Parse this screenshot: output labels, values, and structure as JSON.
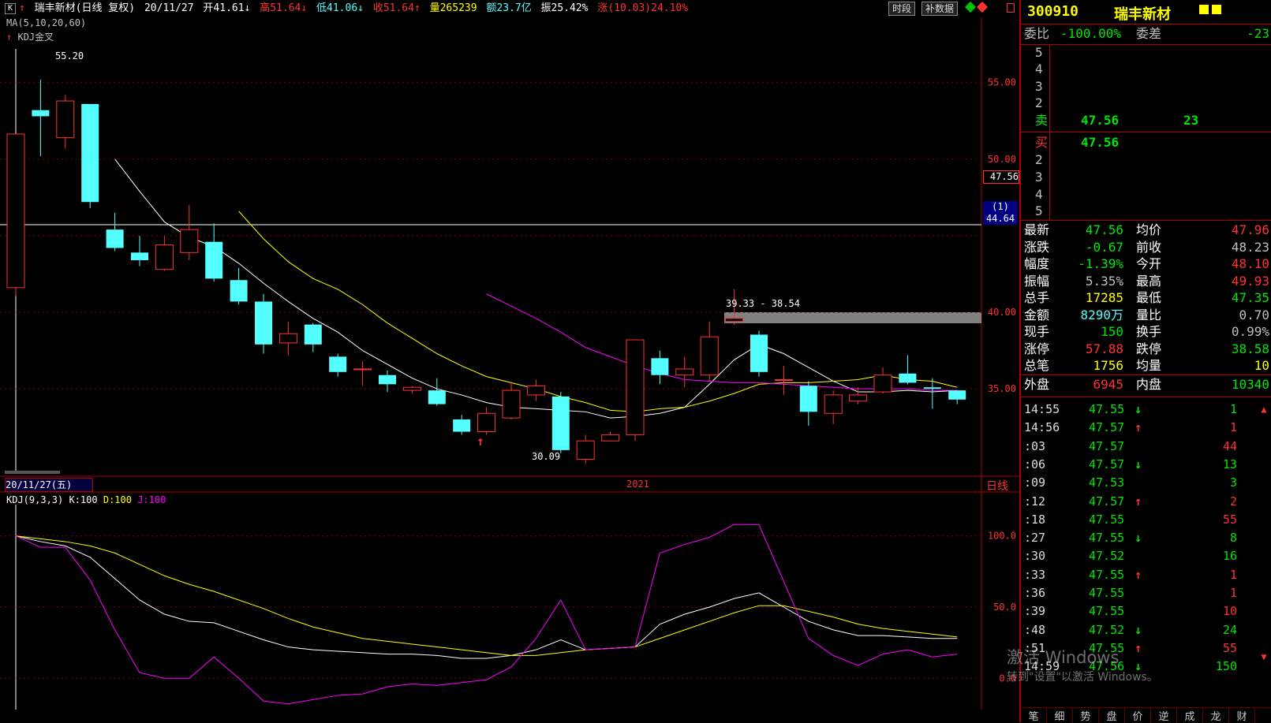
{
  "header": {
    "k_icon": "K",
    "name": "瑞丰新材(日线 复权)",
    "date": "20/11/27",
    "open": "开41.61↓",
    "high": "高51.64↓",
    "low": "低41.06↓",
    "close": "收51.64↑",
    "volume": "量265239",
    "amount": "额23.7亿",
    "amplitude": "振25.42%",
    "change": "涨(10.03)24.10%",
    "btn_timeshare": "时段",
    "btn_supplement": "补数据",
    "ma_legend": "MA(5,10,20,60)",
    "kdj_cross": "KDJ金叉"
  },
  "price_axis": [
    "55.00",
    "50.00",
    "47.56",
    "44.64",
    "40.00",
    "35.00"
  ],
  "price_axis_box": "(1)",
  "chart_labels": {
    "high_label": "55.20",
    "low_label": "30.09",
    "gap_label": "39.33 - 38.54",
    "date_box": "20/11/27(五)",
    "year_label": "2021",
    "period": "日线"
  },
  "kdj": {
    "legend_name": "KDJ(9,3,3)",
    "k": "K:100",
    "d": "D:100",
    "j": "J:100",
    "axis": [
      "100.0",
      "50.0",
      "0.0"
    ]
  },
  "colors": {
    "up": "#ff3232",
    "down": "#54ffff",
    "ma5": "#ffffff",
    "ma10": "#ffff00",
    "ma20": "#ff00ff",
    "panel_border": "#b00000"
  },
  "chart_data": {
    "type": "candlestick",
    "candles": [
      {
        "o": 41.61,
        "c": 51.64,
        "h": 51.64,
        "l": 41.06,
        "dir": "up"
      },
      {
        "o": 52.8,
        "c": 53.2,
        "h": 55.2,
        "l": 50.2,
        "dir": "down"
      },
      {
        "o": 51.4,
        "c": 53.8,
        "h": 54.2,
        "l": 50.7,
        "dir": "up"
      },
      {
        "o": 53.6,
        "c": 47.2,
        "h": 53.6,
        "l": 46.8,
        "dir": "down"
      },
      {
        "o": 45.4,
        "c": 44.2,
        "h": 46.5,
        "l": 44.0,
        "dir": "down"
      },
      {
        "o": 43.9,
        "c": 43.4,
        "h": 45.0,
        "l": 43.0,
        "dir": "down"
      },
      {
        "o": 42.8,
        "c": 44.4,
        "h": 45.0,
        "l": 42.7,
        "dir": "up"
      },
      {
        "o": 43.9,
        "c": 45.4,
        "h": 47.0,
        "l": 43.4,
        "dir": "up"
      },
      {
        "o": 44.6,
        "c": 42.2,
        "h": 45.8,
        "l": 42.0,
        "dir": "down"
      },
      {
        "o": 42.1,
        "c": 40.7,
        "h": 42.9,
        "l": 40.5,
        "dir": "down"
      },
      {
        "o": 40.7,
        "c": 37.9,
        "h": 41.2,
        "l": 37.3,
        "dir": "down"
      },
      {
        "o": 38.0,
        "c": 38.6,
        "h": 39.4,
        "l": 37.2,
        "dir": "up"
      },
      {
        "o": 39.2,
        "c": 37.9,
        "h": 39.3,
        "l": 37.4,
        "dir": "down"
      },
      {
        "o": 37.1,
        "c": 36.1,
        "h": 37.3,
        "l": 35.8,
        "dir": "down"
      },
      {
        "o": 36.3,
        "c": 36.3,
        "h": 36.8,
        "l": 35.2,
        "dir": "up"
      },
      {
        "o": 35.9,
        "c": 35.3,
        "h": 36.2,
        "l": 34.8,
        "dir": "down"
      },
      {
        "o": 34.9,
        "c": 35.1,
        "h": 35.2,
        "l": 34.7,
        "dir": "up"
      },
      {
        "o": 34.9,
        "c": 34.0,
        "h": 35.7,
        "l": 33.9,
        "dir": "down"
      },
      {
        "o": 33.0,
        "c": 32.2,
        "h": 33.3,
        "l": 32.0,
        "dir": "down"
      },
      {
        "o": 32.2,
        "c": 33.4,
        "h": 33.8,
        "l": 32.0,
        "dir": "up"
      },
      {
        "o": 33.1,
        "c": 34.9,
        "h": 35.4,
        "l": 33.0,
        "dir": "up"
      },
      {
        "o": 34.6,
        "c": 35.2,
        "h": 35.6,
        "l": 34.2,
        "dir": "up"
      },
      {
        "o": 34.5,
        "c": 31.0,
        "h": 34.8,
        "l": 30.8,
        "dir": "down"
      },
      {
        "o": 30.4,
        "c": 31.6,
        "h": 32.0,
        "l": 30.09,
        "dir": "up"
      },
      {
        "o": 31.6,
        "c": 32.0,
        "h": 32.2,
        "l": 31.6,
        "dir": "up"
      },
      {
        "o": 32.0,
        "c": 38.2,
        "h": 38.2,
        "l": 31.6,
        "dir": "up"
      },
      {
        "o": 37.0,
        "c": 35.9,
        "h": 37.5,
        "l": 35.3,
        "dir": "down"
      },
      {
        "o": 35.9,
        "c": 36.3,
        "h": 37.1,
        "l": 35.1,
        "dir": "up"
      },
      {
        "o": 35.9,
        "c": 38.4,
        "h": 39.4,
        "l": 35.5,
        "dir": "up"
      },
      {
        "o": 39.4,
        "c": 39.6,
        "h": 41.5,
        "l": 39.2,
        "dir": "up"
      },
      {
        "o": 38.54,
        "c": 36.1,
        "h": 38.8,
        "l": 35.8,
        "dir": "down"
      },
      {
        "o": 35.6,
        "c": 35.6,
        "h": 36.5,
        "l": 34.6,
        "dir": "up"
      },
      {
        "o": 35.2,
        "c": 33.5,
        "h": 35.5,
        "l": 32.6,
        "dir": "down"
      },
      {
        "o": 33.4,
        "c": 34.6,
        "h": 34.9,
        "l": 32.7,
        "dir": "up"
      },
      {
        "o": 34.2,
        "c": 34.6,
        "h": 35.1,
        "l": 34.0,
        "dir": "up"
      },
      {
        "o": 34.8,
        "c": 35.9,
        "h": 36.4,
        "l": 34.7,
        "dir": "up"
      },
      {
        "o": 36.0,
        "c": 35.4,
        "h": 37.2,
        "l": 35.3,
        "dir": "down"
      },
      {
        "o": 35.1,
        "c": 35.0,
        "h": 35.7,
        "l": 33.7,
        "dir": "down"
      },
      {
        "o": 34.9,
        "c": 34.3,
        "h": 34.9,
        "l": 34.0,
        "dir": "down"
      }
    ],
    "ma5": [
      null,
      null,
      null,
      null,
      50.0,
      47.9,
      45.9,
      44.9,
      44.3,
      43.2,
      41.9,
      40.7,
      39.6,
      38.7,
      37.5,
      36.6,
      35.7,
      35.0,
      34.6,
      34.1,
      33.8,
      33.7,
      33.6,
      33.5,
      33.1,
      33.2,
      33.4,
      33.8,
      35.3,
      36.9,
      37.9,
      37.3,
      36.4,
      35.5,
      34.8,
      34.8,
      34.9,
      34.8,
      34.9
    ],
    "ma10": [
      null,
      null,
      null,
      null,
      null,
      null,
      null,
      null,
      null,
      46.6,
      44.8,
      43.3,
      42.2,
      41.5,
      40.5,
      39.3,
      38.3,
      37.3,
      36.5,
      35.8,
      35.4,
      35.0,
      34.5,
      34.1,
      33.6,
      33.5,
      33.7,
      33.8,
      34.2,
      34.7,
      35.3,
      35.4,
      35.4,
      35.5,
      35.6,
      35.9,
      35.6,
      35.5,
      35.1
    ],
    "ma20": [
      null,
      null,
      null,
      null,
      null,
      null,
      null,
      null,
      null,
      null,
      null,
      null,
      null,
      null,
      null,
      null,
      null,
      null,
      null,
      41.2,
      40.4,
      39.6,
      38.7,
      37.7,
      37.1,
      36.5,
      36.0,
      35.6,
      35.5,
      35.4,
      35.4,
      35.3,
      35.2,
      35.1,
      35.0,
      35.0,
      35.0,
      34.9,
      34.9
    ],
    "kdj_k": [
      100,
      96,
      93,
      85,
      70,
      55,
      45,
      40,
      39,
      33,
      27,
      22,
      20,
      19,
      18,
      17,
      17,
      16,
      14,
      14,
      16,
      20,
      27,
      20,
      21,
      22,
      38,
      45,
      50,
      56,
      60,
      50,
      40,
      34,
      30,
      30,
      29,
      28,
      28
    ],
    "kdj_d": [
      100,
      98,
      96,
      93,
      88,
      80,
      72,
      66,
      61,
      55,
      49,
      42,
      36,
      32,
      28,
      26,
      24,
      22,
      20,
      18,
      16,
      16,
      18,
      20,
      21,
      22,
      28,
      34,
      40,
      46,
      51,
      51,
      47,
      43,
      38,
      35,
      33,
      31,
      29
    ],
    "kdj_j": [
      100,
      92,
      92,
      69,
      34,
      4,
      0,
      0,
      15,
      0,
      -16,
      -18,
      -15,
      -12,
      -11,
      -6,
      -4,
      -5,
      -3,
      -1,
      8,
      28,
      55,
      20,
      21,
      22,
      88,
      94,
      99,
      108,
      108,
      68,
      28,
      16,
      9,
      17,
      20,
      15,
      17
    ],
    "ylim_price": [
      29.5,
      57.2
    ],
    "ylim_kdj": [
      -22,
      122
    ]
  },
  "quote": {
    "code": "300910",
    "name": "瑞丰新材",
    "wei_bi_label": "委比",
    "wei_bi": "-100.00%",
    "wei_cha_label": "委差",
    "wei_cha": "-23",
    "sell_levels": [
      "5",
      "4",
      "3",
      "2"
    ],
    "sell_label": "卖",
    "sell_price": "47.56",
    "sell_vol": "23",
    "buy_label": "买",
    "buy_price": "47.56",
    "buy_levels": [
      "2",
      "3",
      "4",
      "5"
    ],
    "stats": [
      {
        "l1": "最新",
        "v1": "47.56",
        "c1": "green",
        "l2": "均价",
        "v2": "47.96",
        "c2": "red"
      },
      {
        "l1": "涨跌",
        "v1": "-0.67",
        "c1": "green",
        "l2": "前收",
        "v2": "48.23",
        "c2": "gray"
      },
      {
        "l1": "幅度",
        "v1": "-1.39%",
        "c1": "green",
        "l2": "今开",
        "v2": "48.10",
        "c2": "red"
      },
      {
        "l1": "振幅",
        "v1": "5.35%",
        "c1": "gray",
        "l2": "最高",
        "v2": "49.93",
        "c2": "red"
      },
      {
        "l1": "总手",
        "v1": "17285",
        "c1": "yellow",
        "l2": "最低",
        "v2": "47.35",
        "c2": "green"
      },
      {
        "l1": "金额",
        "v1": "8290万",
        "c1": "cyan",
        "l2": "量比",
        "v2": "0.70",
        "c2": "gray"
      },
      {
        "l1": "现手",
        "v1": "150",
        "c1": "green",
        "l2": "换手",
        "v2": "0.99%",
        "c2": "gray"
      },
      {
        "l1": "涨停",
        "v1": "57.88",
        "c1": "red",
        "l2": "跌停",
        "v2": "38.58",
        "c2": "green"
      },
      {
        "l1": "总笔",
        "v1": "1756",
        "c1": "yellow",
        "l2": "均量",
        "v2": "10",
        "c2": "yellow"
      }
    ],
    "outer_label": "外盘",
    "outer": "6945",
    "inner_label": "内盘",
    "inner": "10340"
  },
  "ticks": [
    {
      "t": "14:55",
      "p": "47.55",
      "d": "↓",
      "dc": "green",
      "q": "1",
      "qc": "green"
    },
    {
      "t": "14:56",
      "p": "47.57",
      "d": "↑",
      "dc": "red",
      "q": "1",
      "qc": "red"
    },
    {
      "t": ":03",
      "p": "47.57",
      "d": "",
      "dc": "red",
      "q": "44",
      "qc": "red"
    },
    {
      "t": ":06",
      "p": "47.57",
      "d": "↓",
      "dc": "green",
      "q": "13",
      "qc": "green"
    },
    {
      "t": ":09",
      "p": "47.53",
      "d": "",
      "dc": "green",
      "q": "3",
      "qc": "green"
    },
    {
      "t": ":12",
      "p": "47.57",
      "d": "↑",
      "dc": "red",
      "q": "2",
      "qc": "red"
    },
    {
      "t": ":18",
      "p": "47.55",
      "d": "",
      "dc": "red",
      "q": "55",
      "qc": "red"
    },
    {
      "t": ":27",
      "p": "47.55",
      "d": "↓",
      "dc": "green",
      "q": "8",
      "qc": "green"
    },
    {
      "t": ":30",
      "p": "47.52",
      "d": "",
      "dc": "green",
      "q": "16",
      "qc": "green"
    },
    {
      "t": ":33",
      "p": "47.55",
      "d": "↑",
      "dc": "red",
      "q": "1",
      "qc": "red"
    },
    {
      "t": ":36",
      "p": "47.55",
      "d": "",
      "dc": "red",
      "q": "1",
      "qc": "red"
    },
    {
      "t": ":39",
      "p": "47.55",
      "d": "",
      "dc": "red",
      "q": "10",
      "qc": "red"
    },
    {
      "t": ":48",
      "p": "47.52",
      "d": "↓",
      "dc": "green",
      "q": "24",
      "qc": "green"
    },
    {
      "t": ":51",
      "p": "47.55",
      "d": "↑",
      "dc": "red",
      "q": "55",
      "qc": "red"
    },
    {
      "t": "14:59",
      "p": "47.56",
      "d": "↓",
      "dc": "green",
      "q": "150",
      "qc": "green"
    }
  ],
  "tabs": [
    "笔",
    "细",
    "势",
    "盘",
    "价",
    "逆",
    "成",
    "龙",
    "财"
  ],
  "watermark": {
    "title": "激活 Windows",
    "subtitle": "转到\"设置\"以激活 Windows。"
  }
}
